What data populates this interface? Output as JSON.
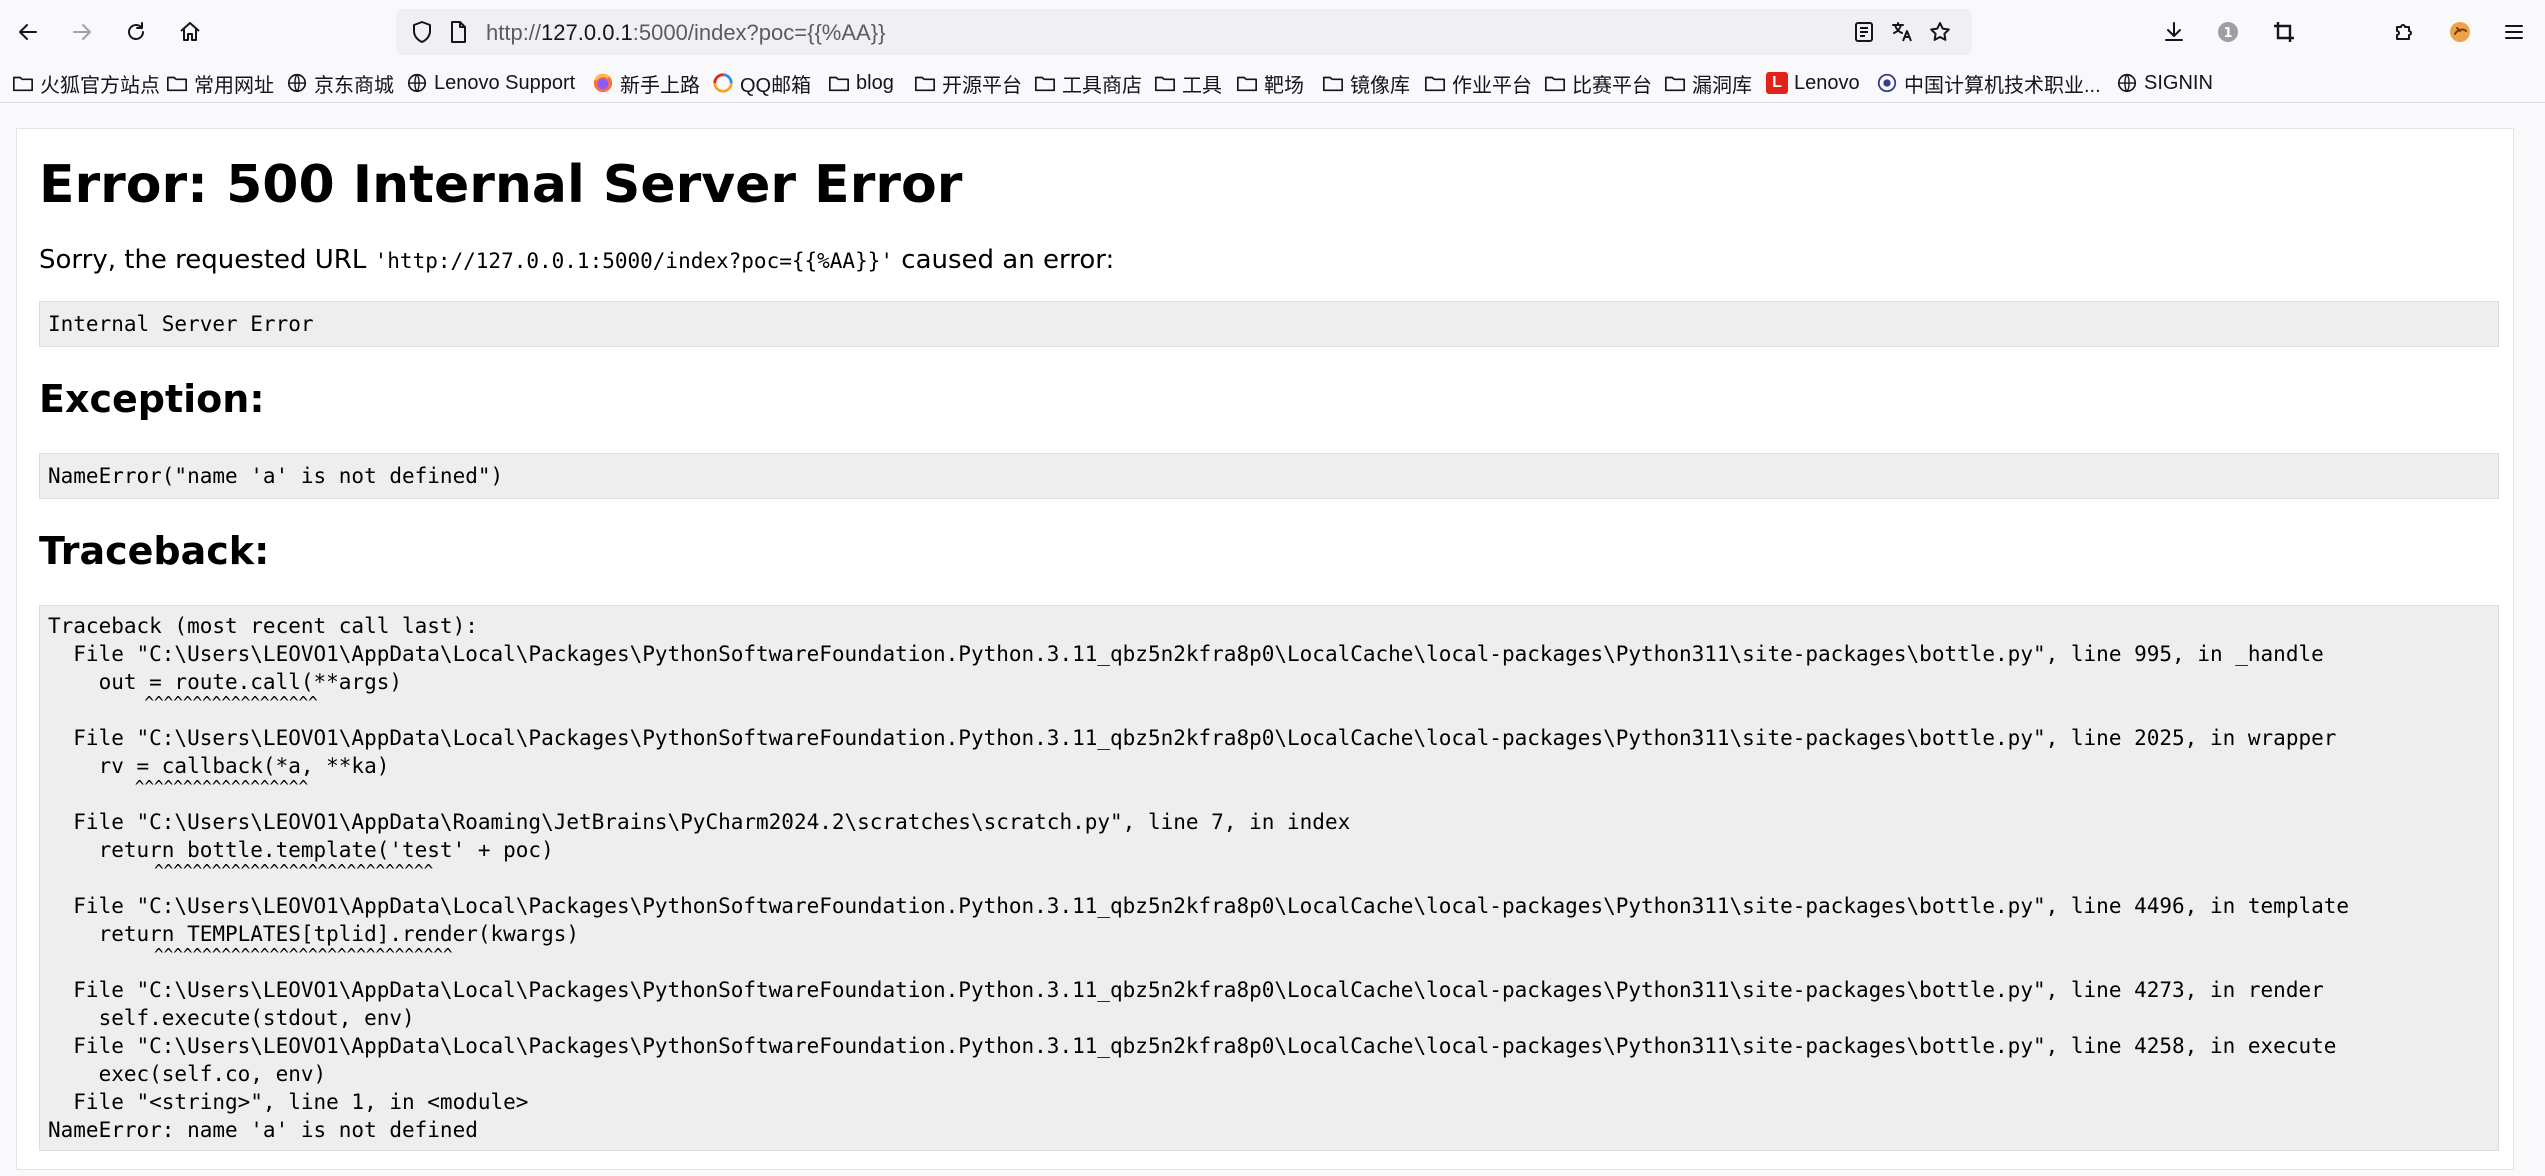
{
  "browser": {
    "url_prefix": "http://",
    "url_host": "127.0.0.1",
    "url_rest": ":5000/index?poc={{%AA}}",
    "icons": {
      "back": "back-arrow-icon",
      "forward": "forward-arrow-icon",
      "reload": "reload-icon",
      "home": "home-icon",
      "shield": "shield-icon",
      "page": "page-icon",
      "reader": "reader-view-icon",
      "translate": "translate-icon",
      "bookmark": "star-icon",
      "downloads": "download-icon",
      "account": "account-icon",
      "screenshot": "crop-icon",
      "extensions": "puzzle-icon",
      "profile": "profile-icon",
      "menu": "hamburger-icon"
    },
    "colors": {
      "toolbar_bg": "#f9f9fb",
      "urlbar_bg": "#f0f0f4",
      "lenovo_red": "#e2231a"
    }
  },
  "bookmarks": [
    {
      "label": "火狐官方站点",
      "icon": "folder-icon"
    },
    {
      "label": "常用网址",
      "icon": "folder-icon"
    },
    {
      "label": "京东商城",
      "icon": "globe-icon"
    },
    {
      "label": "Lenovo Support",
      "icon": "globe-icon"
    },
    {
      "label": "新手上路",
      "icon": "firefox-icon"
    },
    {
      "label": "QQ邮箱",
      "icon": "qq-mail-icon"
    },
    {
      "label": "blog",
      "icon": "folder-icon"
    },
    {
      "label": "开源平台",
      "icon": "folder-icon"
    },
    {
      "label": "工具商店",
      "icon": "folder-icon"
    },
    {
      "label": "工具",
      "icon": "folder-icon"
    },
    {
      "label": "靶场",
      "icon": "folder-icon"
    },
    {
      "label": "镜像库",
      "icon": "folder-icon"
    },
    {
      "label": "作业平台",
      "icon": "folder-icon"
    },
    {
      "label": "比赛平台",
      "icon": "folder-icon"
    },
    {
      "label": "漏洞库",
      "icon": "folder-icon"
    },
    {
      "label": "Lenovo",
      "icon": "lenovo-icon",
      "badge": "L"
    },
    {
      "label": "中国计算机技术职业...",
      "icon": "site-icon"
    },
    {
      "label": "SIGNIN",
      "icon": "globe-icon"
    }
  ],
  "page": {
    "title": "Error: 500 Internal Server Error",
    "sorry_before": "Sorry, the requested URL ",
    "sorry_url": "'http://127.0.0.1:5000/index?poc={{%AA}}'",
    "sorry_after": " caused an error:",
    "error_body": "Internal Server Error",
    "exception_heading": "Exception:",
    "exception_text": "NameError(\"name 'a' is not defined\")",
    "traceback_heading": "Traceback:",
    "traceback_lines": [
      "Traceback (most recent call last):",
      "  File \"C:\\Users\\LEOVO1\\AppData\\Local\\Packages\\PythonSoftwareFoundation.Python.3.11_qbz5n2kfra8p0\\LocalCache\\local-packages\\Python311\\site-packages\\bottle.py\", line 995, in _handle",
      "    out = route.call(**args)",
      "          ^^^^^^^^^^^^^^^^^^",
      "  File \"C:\\Users\\LEOVO1\\AppData\\Local\\Packages\\PythonSoftwareFoundation.Python.3.11_qbz5n2kfra8p0\\LocalCache\\local-packages\\Python311\\site-packages\\bottle.py\", line 2025, in wrapper",
      "    rv = callback(*a, **ka)",
      "         ^^^^^^^^^^^^^^^^^^",
      "  File \"C:\\Users\\LEOVO1\\AppData\\Roaming\\JetBrains\\PyCharm2024.2\\scratches\\scratch.py\", line 7, in index",
      "    return bottle.template('test' + poc)",
      "           ^^^^^^^^^^^^^^^^^^^^^^^^^^^^^",
      "  File \"C:\\Users\\LEOVO1\\AppData\\Local\\Packages\\PythonSoftwareFoundation.Python.3.11_qbz5n2kfra8p0\\LocalCache\\local-packages\\Python311\\site-packages\\bottle.py\", line 4496, in template",
      "    return TEMPLATES[tplid].render(kwargs)",
      "           ^^^^^^^^^^^^^^^^^^^^^^^^^^^^^^^",
      "  File \"C:\\Users\\LEOVO1\\AppData\\Local\\Packages\\PythonSoftwareFoundation.Python.3.11_qbz5n2kfra8p0\\LocalCache\\local-packages\\Python311\\site-packages\\bottle.py\", line 4273, in render",
      "    self.execute(stdout, env)",
      "  File \"C:\\Users\\LEOVO1\\AppData\\Local\\Packages\\PythonSoftwareFoundation.Python.3.11_qbz5n2kfra8p0\\LocalCache\\local-packages\\Python311\\site-packages\\bottle.py\", line 4258, in execute",
      "    exec(self.co, env)",
      "  File \"<string>\", line 1, in <module>",
      "NameError: name 'a' is not defined"
    ]
  }
}
